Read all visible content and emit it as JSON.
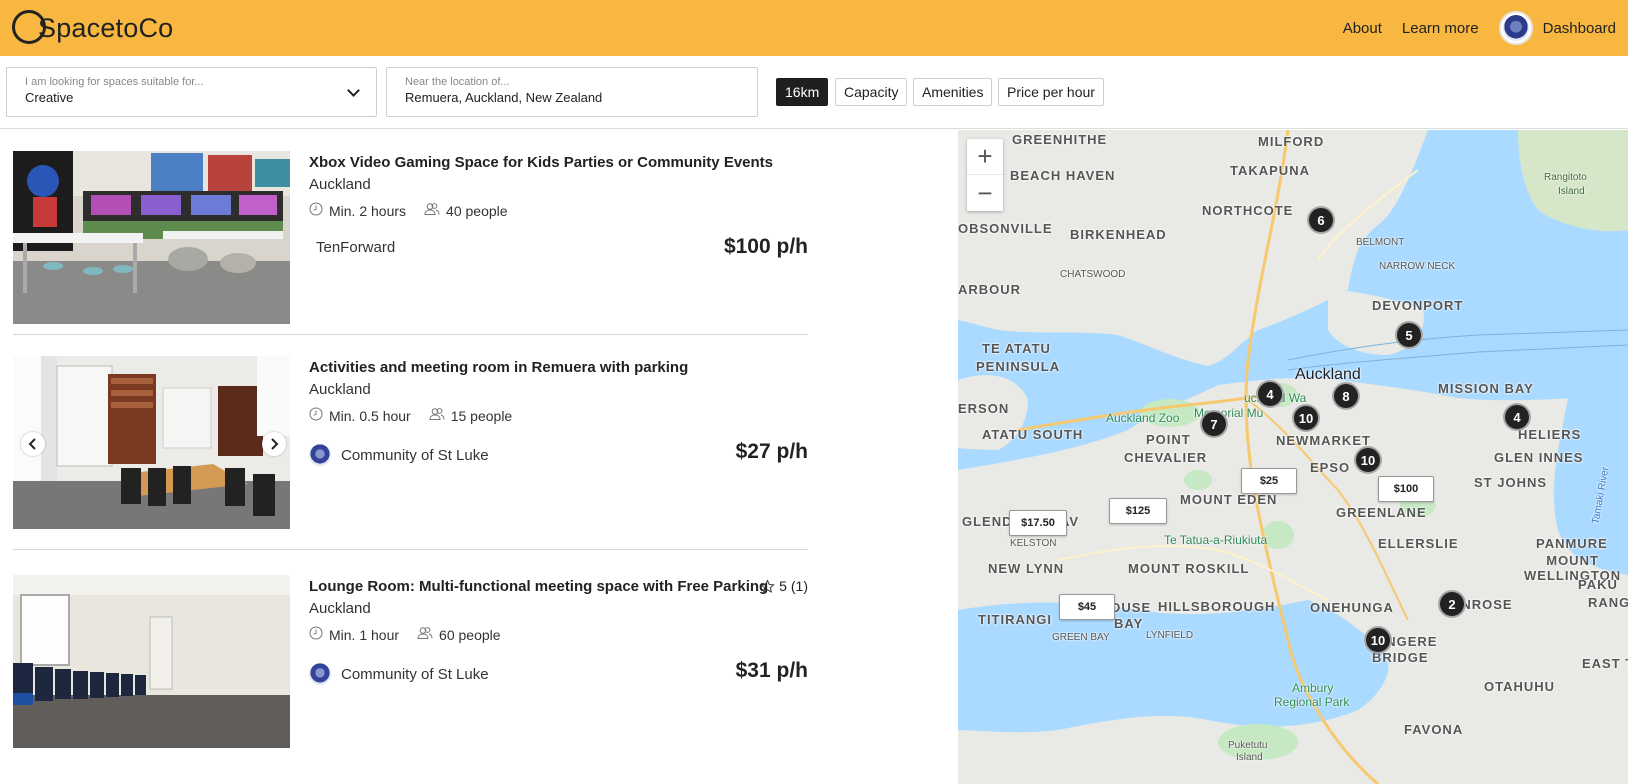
{
  "header": {
    "logo_text": "SpacetoCo",
    "nav": {
      "about": "About",
      "learn_more": "Learn more",
      "dashboard": "Dashboard"
    }
  },
  "search": {
    "suitable_placeholder": "I am looking for spaces suitable for...",
    "suitable_value": "Creative",
    "location_placeholder": "Near the location of...",
    "location_value": "Remuera, Auckland, New Zealand",
    "filters": [
      "16km",
      "Capacity",
      "Amenities",
      "Price per hour"
    ]
  },
  "listings": [
    {
      "title": "Xbox Video Gaming Space for Kids Parties or Community Events",
      "city": "Auckland",
      "min": "Min. 2 hours",
      "capacity": "40 people",
      "host": "TenForward",
      "price": "$100 p/h"
    },
    {
      "title": "Activities and meeting room in Remuera with parking",
      "city": "Auckland",
      "min": "Min. 0.5 hour",
      "capacity": "15 people",
      "host": "Community of St Luke",
      "price": "$27 p/h"
    },
    {
      "title": "Lounge Room: Multi-functional meeting space with Free Parking",
      "city": "Auckland",
      "min": "Min. 1 hour",
      "capacity": "60 people",
      "host": "Community of St Luke",
      "price": "$31 p/h",
      "rating": "5",
      "rating_count": "(1)"
    }
  ],
  "map": {
    "zoom_in": "+",
    "zoom_out": "−",
    "clusters": [
      "6",
      "5",
      "4",
      "8",
      "10",
      "7",
      "4",
      "10",
      "2",
      "10"
    ],
    "price_pins": [
      "$25",
      "$100",
      "$125",
      "$17.50",
      "$45"
    ],
    "labels": {
      "greenhithe": "GREENHITHE",
      "milford": "MILFORD",
      "takapuna": "TAKAPUNA",
      "beach_haven": "BEACH HAVEN",
      "northcote": "NORTHCOTE",
      "birkenhead": "BIRKENHEAD",
      "devonport": "DEVONPORT",
      "arbour": "ARBOUR",
      "obsonville": "OBSONVILLE",
      "te_atatu": "TE ATATU",
      "peninsula": "PENINSULA",
      "auckland": "Auckland",
      "mission_bay": "MISSION BAY",
      "auckland_zoo": "Auckland Zoo",
      "erson": "ERSON",
      "atatu_south": "ATATU SOUTH",
      "point": "POINT",
      "chevalier": "CHEVALIER",
      "newmarket": "NEWMARKET",
      "epsom": "EPSO",
      "heliers": "HELIERS",
      "glen_innes": "GLEN INNES",
      "mount_eden": "MOUNT EDEN",
      "st_johns": "ST JOHNS",
      "glend": "GLEND",
      "av": "AV",
      "greenlane": "GREENLANE",
      "te_tatua": "Te Tatua-a-Riukiuta",
      "ellerslie": "ELLERSLIE",
      "panmure": "PANMURE",
      "new_lynn": "NEW LYNN",
      "mount_roskill": "MOUNT ROSKILL",
      "mount_wellington": "MOUNT\nWELLINGTON",
      "ockhouse": "OCKHOUSE",
      "bay": "BAY",
      "hillsborough": "HILLSBOROUGH",
      "titirangi": "TITIRANGI",
      "onehunga": "ONEHUNGA",
      "penrose": "PENROSE",
      "mangere": "MANGERE",
      "bridge": "BRIDGE",
      "east_t": "EAST T",
      "otahuhu": "OTAHUHU",
      "favona": "FAVONA",
      "ambury": "Ambury",
      "regional_park": "Regional Park",
      "rangitoto": "Rangitoto",
      "island": "Island",
      "puketutu": "Puketutu",
      "puketutu_island": "Island",
      "chatswood": "CHATSWOOD",
      "belmont": "BELMONT",
      "narrow_neck": "NARROW NECK",
      "kelston": "KELSTON",
      "green_bay": "GREEN BAY",
      "lynfield": "LYNFIELD",
      "tamaki_river": "Tamaki River",
      "pakuranga": "PAKU",
      "ranga": "RANGA",
      "memorial_museum": "Memorial Mu",
      "auckland_waterfront": "uckland Wa"
    }
  },
  "colors": {
    "header_bg": "#f8b740",
    "water": "#aadaff",
    "land": "#e8e8e8",
    "park": "#c6e8c3",
    "cluster": "#222222"
  }
}
